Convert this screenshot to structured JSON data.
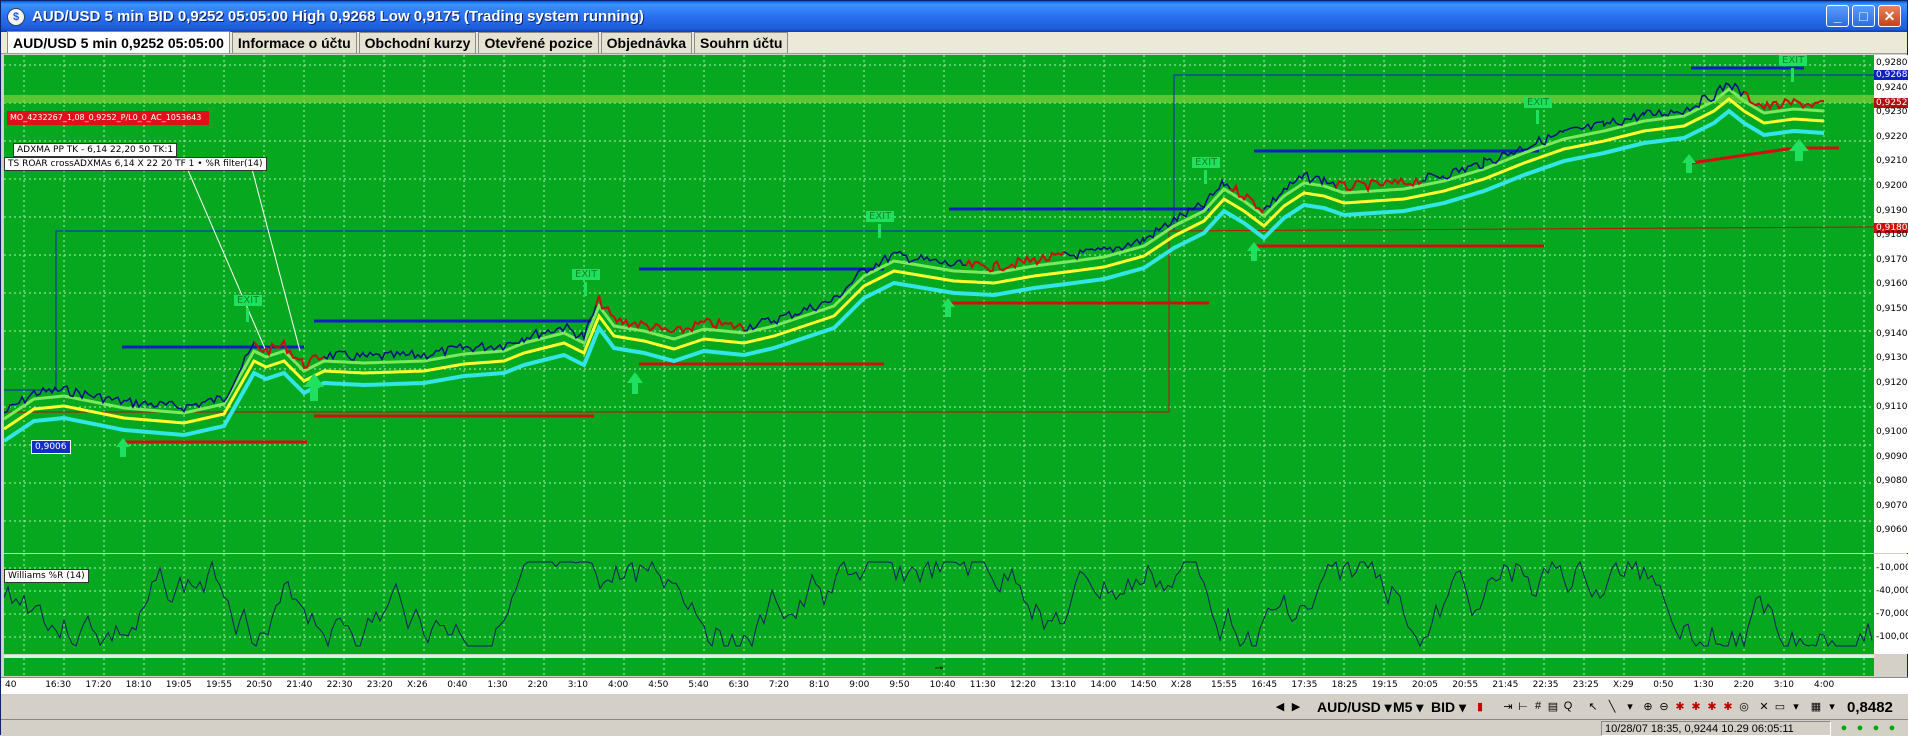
{
  "window": {
    "title": "AUD/USD 5 min BID 0,9252 05:05:00 High 0,9268 Low 0,9175 (Trading system running)",
    "minimize": "_",
    "maximize": "□",
    "close": "✕"
  },
  "tabs": [
    {
      "label": "AUD/USD 5 min 0,9252 05:05:00"
    },
    {
      "label": "Informace o účtu"
    },
    {
      "label": "Obchodní kurzy"
    },
    {
      "label": "Otevřené pozice"
    },
    {
      "label": "Objednávka"
    },
    {
      "label": "Souhrn účtu"
    }
  ],
  "chart": {
    "order_tag": "MO_4232267_1,08_0,9252_P/L0_0_AC_1053643",
    "indicator_label_1": "ADXMA PP TK - 6,14  22,20  50  TK:1",
    "indicator_label_2": "TS ROAR crossADXMAs 6,14 X 22 20  TF 1 • %R filter(14)",
    "exit_label": "EXIT",
    "low_flag": "0,9006",
    "price_labels": [
      "0,9280",
      "0,9268",
      "0,9252",
      "0,9240",
      "0,9230",
      "0,9220",
      "0,9210",
      "0,9200",
      "0,9190",
      "0,9180",
      "0,9170",
      "0,9160",
      "0,9150",
      "0,9140",
      "0,9130",
      "0,9120",
      "0,9110",
      "0,9100",
      "0,9090",
      "0,9080",
      "0,9070",
      "0,9060"
    ],
    "flag_high": "0,9268",
    "flag_bid": "0,9252",
    "flag_mid": "0,9180"
  },
  "oscillator": {
    "label": "Williams %R (14)",
    "levels": [
      "-10,000",
      "-40,000",
      "-70,000",
      "-100,00"
    ]
  },
  "time_axis": [
    "40",
    "16:30",
    "17:20",
    "18:10",
    "19:05",
    "19:55",
    "20:50",
    "21:40",
    "22:30",
    "23:20",
    "X:26",
    "0:40",
    "1:30",
    "2:20",
    "3:10",
    "4:00",
    "4:50",
    "5:40",
    "6:30",
    "7:20",
    "8:10",
    "9:00",
    "9:50",
    "10:40",
    "11:30",
    "12:20",
    "13:10",
    "14:00",
    "14:50",
    "X:28",
    "15:55",
    "16:45",
    "17:35",
    "18:25",
    "19:15",
    "20:05",
    "20:55",
    "21:45",
    "22:35",
    "23:25",
    "X:29",
    "0:50",
    "1:30",
    "2:20",
    "3:10",
    "4:00"
  ],
  "toolbar": {
    "symbol": "AUD/USD",
    "timeframe": "M5",
    "side": "BID",
    "price": "0,8482"
  },
  "status": {
    "range": "10/28/07 18:35, 0,9244  10.29 06:05:11"
  },
  "colors": {
    "chart_bg": "#06a81f",
    "price_line": "#001080",
    "blue_level": "#1020c0",
    "red_level": "#d01010",
    "yellow_ma": "#ffff33",
    "cyan_ma": "#33e6e6",
    "light_green_ma": "#7ce85c"
  }
}
